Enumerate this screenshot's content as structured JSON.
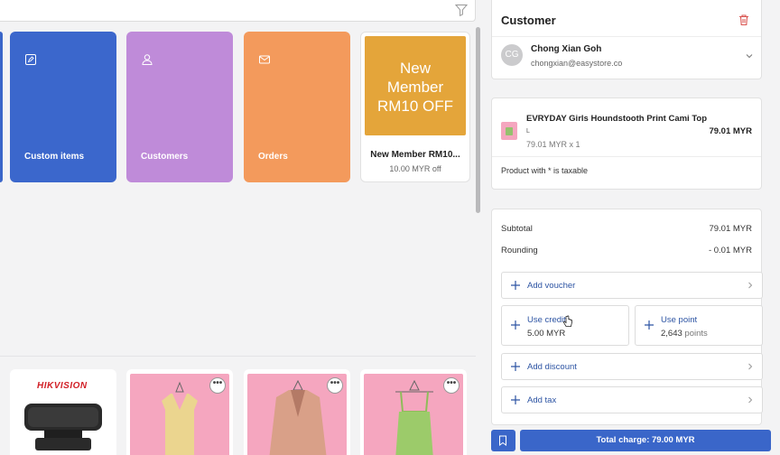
{
  "tiles": {
    "custom_items": "Custom items",
    "customers": "Customers",
    "orders": "Orders"
  },
  "promo": {
    "image_line1": "New",
    "image_line2": "Member",
    "image_line3": "RM10 OFF",
    "name": "New Member RM10...",
    "subtitle": "10.00 MYR off"
  },
  "products": [
    {
      "brand": "HIKVISION",
      "menu": "•••"
    },
    {
      "menu": "•••"
    },
    {
      "menu": "•••"
    },
    {
      "menu": "•••"
    }
  ],
  "customer": {
    "title": "Customer",
    "initials": "CG",
    "name": "Chong Xian Goh",
    "email": "chongxian@easystore.co"
  },
  "cart": {
    "item_name": "EVRYDAY Girls Houndstooth Print Cami Top",
    "item_variant": "L",
    "item_qty": "79.01 MYR x 1",
    "item_price": "79.01 MYR",
    "tax_note": "Product with * is taxable"
  },
  "summary": {
    "subtotal_label": "Subtotal",
    "subtotal_value": "79.01 MYR",
    "rounding_label": "Rounding",
    "rounding_value": "- 0.01 MYR",
    "add_voucher": "Add voucher",
    "use_credit": "Use credit",
    "credit_value": "5.00 MYR",
    "use_point": "Use point",
    "point_value": "2,643",
    "point_unit": "points",
    "add_discount": "Add discount",
    "add_tax": "Add tax"
  },
  "footer": {
    "total_charge": "Total charge: 79.00 MYR"
  },
  "colors": {
    "accent": "#3a66c9",
    "custom_tile": "#3b67cc",
    "customers_tile": "#bf8bd9",
    "orders_tile": "#f39a5c",
    "promo_bg": "#e4a53a",
    "product_bg": "#f5a6bf",
    "trash": "#d9534f"
  }
}
